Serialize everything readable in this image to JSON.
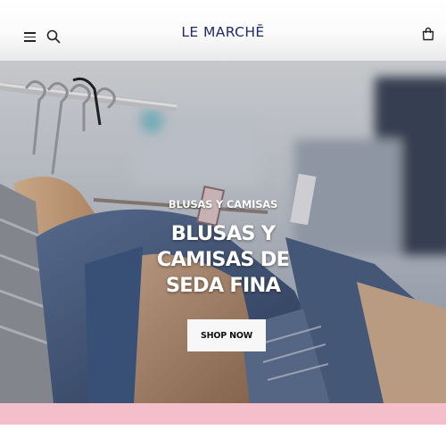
{
  "header": {
    "brand": "LE MARCHĒ",
    "menu_icon": "hamburger-menu-icon",
    "search_icon": "search-icon",
    "cart_icon": "shopping-bag-icon"
  },
  "hero": {
    "eyebrow": "BLUSAS Y CAMISAS",
    "headline_lines": [
      "BLUSAS Y",
      "CAMISAS DE",
      "SEDA FINA"
    ],
    "cta_label": "SHOP NOW"
  },
  "colors": {
    "brand": "#1d2a6b",
    "promo_bar": "#f4bfcb",
    "cta_bg": "#f7f7f7"
  }
}
